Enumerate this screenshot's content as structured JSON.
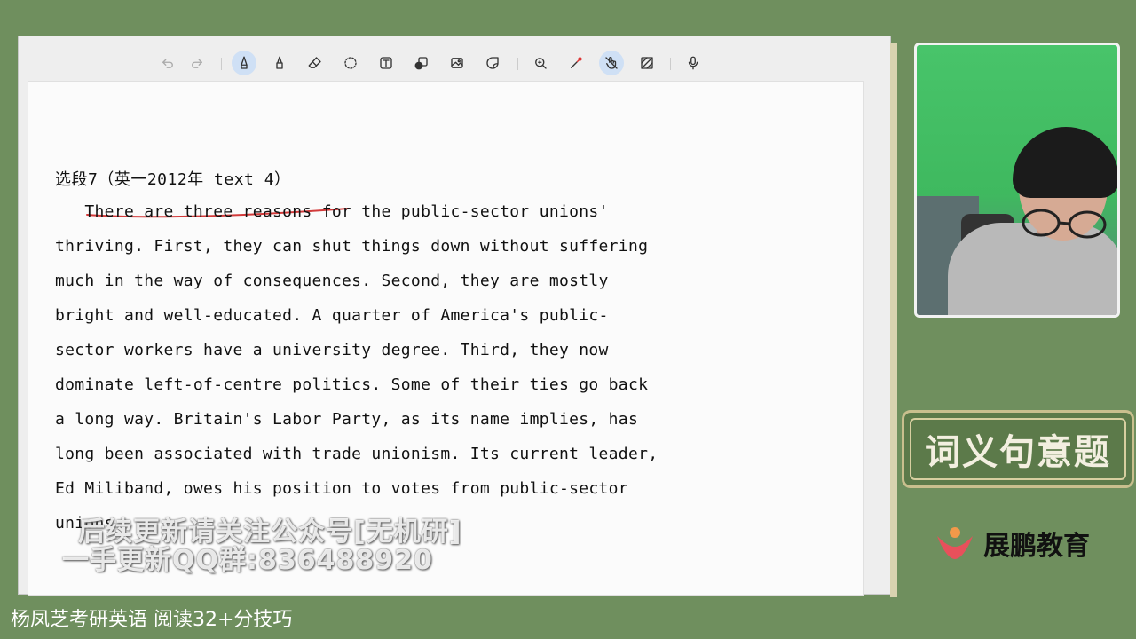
{
  "toolbar": {
    "tools": [
      {
        "name": "undo-icon"
      },
      {
        "name": "redo-icon"
      },
      {
        "name": "pen-icon"
      },
      {
        "name": "highlighter-icon"
      },
      {
        "name": "eraser-icon"
      },
      {
        "name": "lasso-icon"
      },
      {
        "name": "text-box-icon"
      },
      {
        "name": "shapes-icon"
      },
      {
        "name": "image-icon"
      },
      {
        "name": "sticker-icon"
      },
      {
        "name": "zoom-icon"
      },
      {
        "name": "laser-pointer-icon"
      },
      {
        "name": "touch-write-icon"
      },
      {
        "name": "pattern-icon"
      },
      {
        "name": "microphone-icon"
      }
    ],
    "active_tool": "pen-icon"
  },
  "document": {
    "heading": "选段7（英一2012年 text 4）",
    "lines": [
      "   There are three reasons for the public-sector unions'",
      "thriving. First, they can shut things down without suffering",
      "much in the way of consequences. Second, they are mostly",
      "bright and well-educated. A quarter of America's public-",
      "sector workers have a university degree. Third, they now",
      "dominate left-of-centre politics. Some of their ties go back",
      "a long way. Britain's Labor Party, as its name implies, has",
      "long been associated with trade unionism. Its current leader,",
      "Ed Miliband, owes his position to votes from public-sector",
      "unions."
    ]
  },
  "watermark": {
    "line1": "后续更新请关注公众号[无机研]",
    "line2": "一手更新QQ群:836488920"
  },
  "badge": {
    "label": "词义句意题"
  },
  "brand": {
    "name": "展鹏教育"
  },
  "caption": {
    "text": "杨凤芝考研英语  阅读32+分技巧"
  },
  "colors": {
    "background": "#6f8f5e",
    "ink_underline": "#d23a3a",
    "badge_fill": "#5c7a4a",
    "badge_border": "#c9bf8e"
  }
}
